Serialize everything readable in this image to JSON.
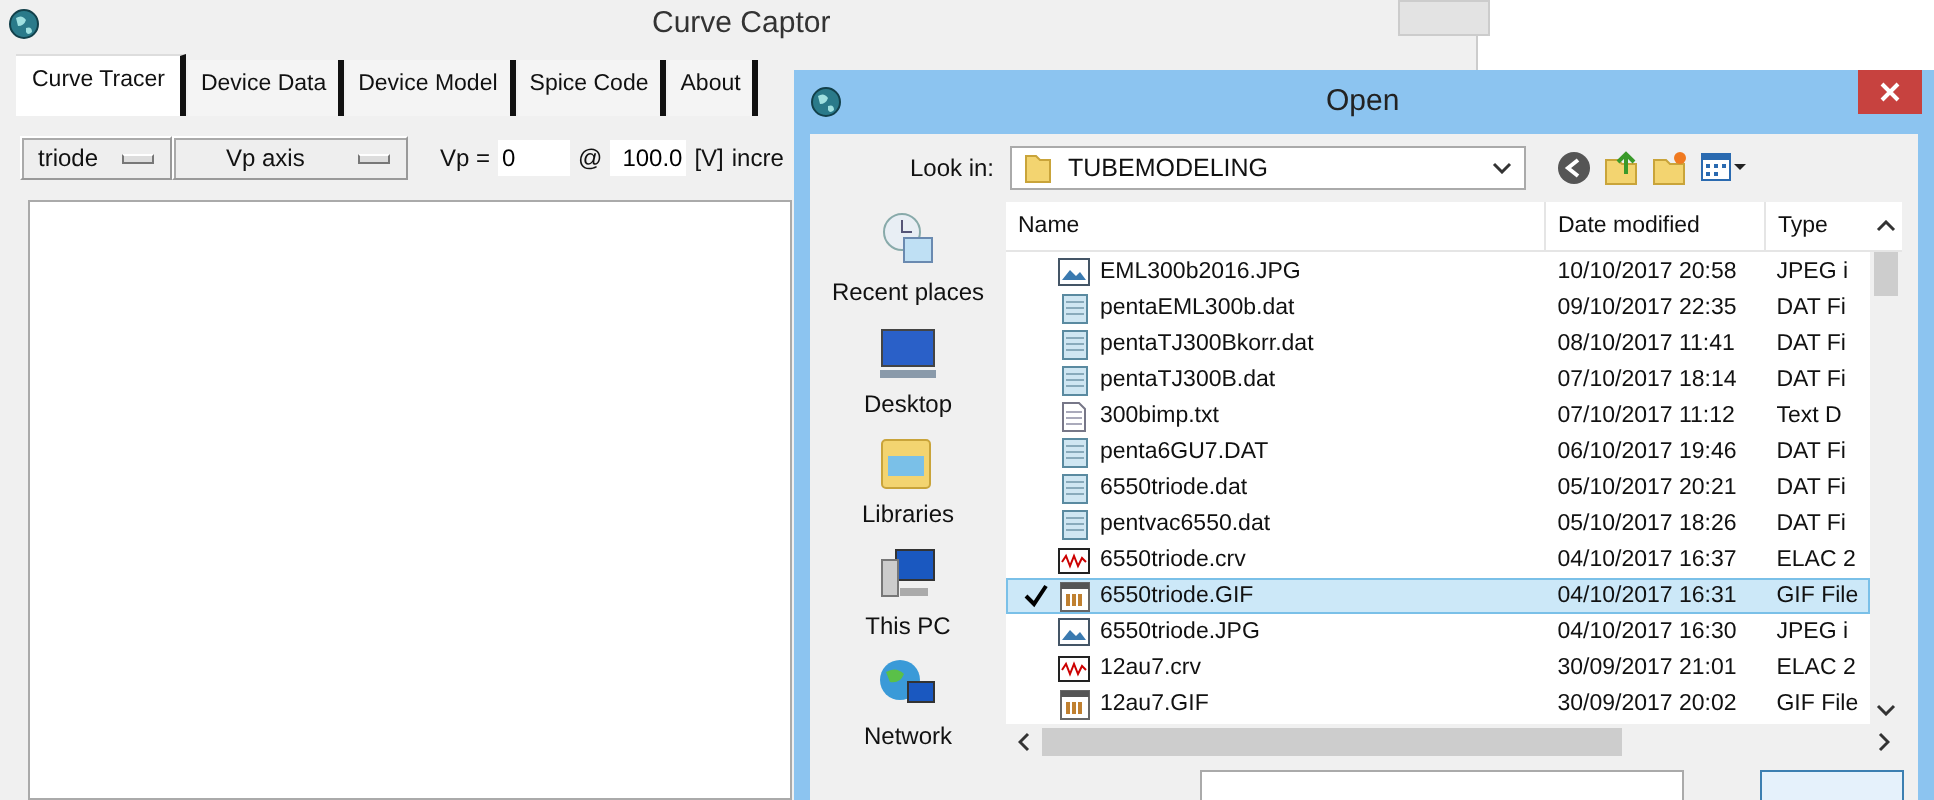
{
  "app": {
    "title": "Curve Captor",
    "tabs": [
      {
        "label": "Curve Tracer",
        "selected": true
      },
      {
        "label": "Device Data",
        "selected": false
      },
      {
        "label": "Device Model",
        "selected": false
      },
      {
        "label": "Spice Code",
        "selected": false
      },
      {
        "label": "About",
        "selected": false
      }
    ],
    "controls": {
      "mode": "triode",
      "axis": "Vp axis",
      "vp_label": "Vp =",
      "vp_value": "0",
      "at_label": "@",
      "step_value": "100.0",
      "unit": "[V]",
      "increment_label": "incre"
    }
  },
  "dialog": {
    "title": "Open",
    "look_in_label": "Look in:",
    "folder": "TUBEMODELING",
    "places": [
      {
        "label": "Recent places",
        "kind": "recent"
      },
      {
        "label": "Desktop",
        "kind": "desktop"
      },
      {
        "label": "Libraries",
        "kind": "libraries"
      },
      {
        "label": "This PC",
        "kind": "pc"
      },
      {
        "label": "Network",
        "kind": "network"
      }
    ],
    "columns": [
      "Name",
      "Date modified",
      "Type"
    ],
    "files": [
      {
        "name": "EML300b2016.JPG",
        "date": "10/10/2017 20:58",
        "type": "JPEG i",
        "kind": "image",
        "selected": false
      },
      {
        "name": "pentaEML300b.dat",
        "date": "09/10/2017 22:35",
        "type": "DAT Fi",
        "kind": "dat",
        "selected": false
      },
      {
        "name": "pentaTJ300Bkorr.dat",
        "date": "08/10/2017 11:41",
        "type": "DAT Fi",
        "kind": "dat",
        "selected": false
      },
      {
        "name": "pentaTJ300B.dat",
        "date": "07/10/2017 18:14",
        "type": "DAT Fi",
        "kind": "dat",
        "selected": false
      },
      {
        "name": "300bimp.txt",
        "date": "07/10/2017 11:12",
        "type": "Text D",
        "kind": "text",
        "selected": false
      },
      {
        "name": "penta6GU7.DAT",
        "date": "06/10/2017 19:46",
        "type": "DAT Fi",
        "kind": "dat",
        "selected": false
      },
      {
        "name": "6550triode.dat",
        "date": "05/10/2017 20:21",
        "type": "DAT Fi",
        "kind": "dat",
        "selected": false
      },
      {
        "name": "pentvac6550.dat",
        "date": "05/10/2017 18:26",
        "type": "DAT Fi",
        "kind": "dat",
        "selected": false
      },
      {
        "name": "6550triode.crv",
        "date": "04/10/2017 16:37",
        "type": "ELAC 2",
        "kind": "curve",
        "selected": false
      },
      {
        "name": "6550triode.GIF",
        "date": "04/10/2017 16:31",
        "type": "GIF File",
        "kind": "gif",
        "selected": true
      },
      {
        "name": "6550triode.JPG",
        "date": "04/10/2017 16:30",
        "type": "JPEG i",
        "kind": "image",
        "selected": false
      },
      {
        "name": "12au7.crv",
        "date": "30/09/2017 21:01",
        "type": "ELAC 2",
        "kind": "curve",
        "selected": false
      },
      {
        "name": "12au7.GIF",
        "date": "30/09/2017 20:02",
        "type": "GIF File",
        "kind": "gif",
        "selected": false
      }
    ]
  }
}
